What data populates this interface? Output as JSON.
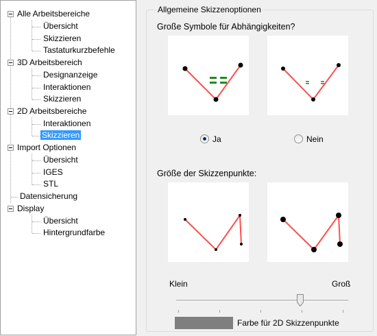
{
  "tree": {
    "groups": [
      {
        "label": "Alle Arbeitsbereiche",
        "items": [
          "Übersicht",
          "Skizzieren",
          "Tastaturkurzbefehle"
        ]
      },
      {
        "label": "3D Arbeitsbereich",
        "items": [
          "Designanzeige",
          "Interaktionen",
          "Skizzieren"
        ]
      },
      {
        "label": "2D Arbeitsbereiche",
        "items": [
          "Interaktionen",
          "Skizzieren"
        ]
      },
      {
        "label": "Import Optionen",
        "items": [
          "Übersicht",
          "IGES",
          "STL"
        ]
      },
      {
        "label": "Datensicherung",
        "items": []
      },
      {
        "label": "Display",
        "items": [
          "Übersicht",
          "Hintergrundfarbe"
        ]
      }
    ],
    "selected": "2D Arbeitsbereiche / Skizzieren"
  },
  "options": {
    "group_title": "Allgemeine Skizzenoptionen",
    "constraint_symbols_label": "Große Symbole für Abhängigkeiten?",
    "radio_yes": "Ja",
    "radio_no": "Nein",
    "radio_selected": "Ja",
    "point_size_label": "Größe der Skizzenpunkte:",
    "slider_min_label": "Klein",
    "slider_max_label": "Groß",
    "slider_value_fraction": 0.73,
    "color_label": "Farbe für 2D Skizzenpunkte",
    "color_swatch": "#7f7f7f"
  },
  "colors": {
    "selection": "#3399ff",
    "sketch_line": "#ff4d4d",
    "constraint_symbol": "#1f8a1f"
  }
}
